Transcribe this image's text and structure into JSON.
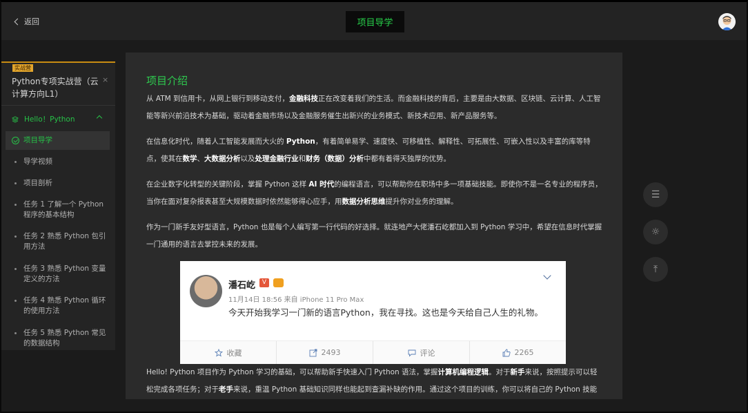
{
  "header": {
    "back_label": "返回",
    "title": "项目导学",
    "avatar_icon": "user-avatar"
  },
  "sidebar": {
    "badge": "实战营",
    "course_title": "Python专项实战营（云计算方向L1）",
    "close_glyph": "×",
    "chapter": "Hello！Python",
    "items": [
      {
        "label": "项目导学",
        "active": true
      },
      {
        "label": "导学视频"
      },
      {
        "label": "项目剖析"
      },
      {
        "label": "任务 1 了解一个 Python 程序的基本结构"
      },
      {
        "label": "任务 2 熟悉 Python 包引用方法"
      },
      {
        "label": "任务 3 熟悉 Python 变量定义的方法"
      },
      {
        "label": "任务 4 熟悉 Python 循环的使用方法"
      },
      {
        "label": "任务 5 熟悉 Python 常见的数据结构"
      }
    ]
  },
  "content": {
    "heading": "项目介绍",
    "p1": [
      {
        "t": "从 ATM 到信用卡，从网上银行到移动支付，"
      },
      {
        "t": "金融科技",
        "b": true
      },
      {
        "t": "正在改变着我们的生活。而金融科技的背后，主要是由大数据、区块链、云计算、人工智能等新兴前沿技术为基础，驱动着金融市场以及金融服务催生出新兴的业务模式、新技术应用、新产品服务等。"
      }
    ],
    "p2": [
      {
        "t": "在信息化时代，随着人工智能发展而大火的 "
      },
      {
        "t": "Python",
        "b": true
      },
      {
        "t": "，有着简单易学、速度快、可移植性、解释性、可拓展性、可嵌入性以及丰富的库等特点，使其在"
      },
      {
        "t": "数学",
        "b": true
      },
      {
        "t": "、"
      },
      {
        "t": "大数据分析",
        "b": true
      },
      {
        "t": "以及"
      },
      {
        "t": "处理金融行业",
        "b": true
      },
      {
        "t": "和"
      },
      {
        "t": "财务（数据）分析",
        "b": true
      },
      {
        "t": "中都有着得天独厚的优势。"
      }
    ],
    "p3": [
      {
        "t": "在企业数字化转型的关键阶段，掌握 Python 这样 "
      },
      {
        "t": "AI 时代",
        "b": true
      },
      {
        "t": "的编程语言，可以帮助你在职场中多一项基础技能。即使你不是一名专业的程序员，当你在面对复杂报表甚至大规模数据时依然能够得心应手，用"
      },
      {
        "t": "数据分析思维",
        "b": true
      },
      {
        "t": "提升你对业务的理解。"
      }
    ],
    "p4": [
      {
        "t": "作为一门新手友好型语言，Python 也是每个人编写第一行代码的好选择。就连地产大佬潘石屹都加入到 Python 学习中，希望在信息时代掌握一门通用的语言去掌控未来的发展。"
      }
    ],
    "p5": [
      {
        "t": "Hello! Python 项目作为 Python 学习的基础，可以帮助新手快速入门 Python 语法，掌握"
      },
      {
        "t": "计算机编程逻辑",
        "b": true
      },
      {
        "t": "。对于"
      },
      {
        "t": "新手",
        "b": true
      },
      {
        "t": "来说，按照提示可以轻松完成各项任务；对于"
      },
      {
        "t": "老手",
        "b": true
      },
      {
        "t": "来说，重温 Python 基础知识同样也能起到查漏补缺的作用。通过这个项目的训练，你可以将自己的 Python 技能水"
      }
    ]
  },
  "weibo": {
    "name": "潘石屹",
    "v_badge": "V",
    "meta": "11月14日 18:56 来自 iPhone 11 Pro Max",
    "text": "今天开始我学习一门新的语言Python，我在寻找。这也是今天给自己人生的礼物。",
    "actions": [
      {
        "label": "收藏",
        "icon": "star-icon"
      },
      {
        "label": "2493",
        "icon": "share-icon"
      },
      {
        "label": "评论",
        "icon": "comment-icon"
      },
      {
        "label": "2265",
        "icon": "like-icon"
      }
    ]
  },
  "tools": [
    {
      "icon": "outline-icon",
      "glyph": "☰"
    },
    {
      "icon": "brightness-icon",
      "glyph": "☼"
    },
    {
      "icon": "back-to-top-icon",
      "glyph": "⤒"
    }
  ]
}
